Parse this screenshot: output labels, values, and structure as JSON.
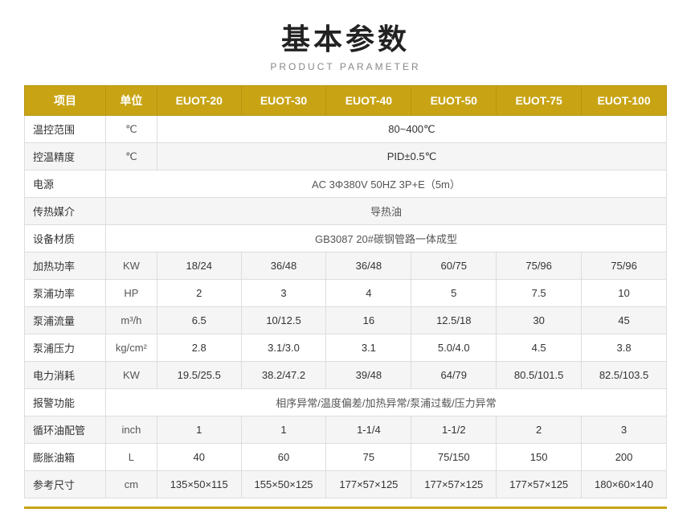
{
  "title": {
    "main": "基本参数",
    "sub": "PRODUCT PARAMETER"
  },
  "table": {
    "headers": [
      "项目",
      "单位",
      "EUOT-20",
      "EUOT-30",
      "EUOT-40",
      "EUOT-50",
      "EUOT-75",
      "EUOT-100"
    ],
    "rows": [
      {
        "label": "温控范围",
        "unit": "℃",
        "span": true,
        "span_value": "80~400℃",
        "span_cols": 6
      },
      {
        "label": "控温精度",
        "unit": "℃",
        "span": true,
        "span_value": "PID±0.5℃",
        "span_cols": 6
      },
      {
        "label": "电源",
        "unit": "",
        "span": true,
        "span_value": "AC 3Φ380V 50HZ 3P+E（5m）",
        "span_cols": 7
      },
      {
        "label": "传热媒介",
        "unit": "",
        "span": true,
        "span_value": "导热油",
        "span_cols": 7
      },
      {
        "label": "设备材质",
        "unit": "",
        "span": true,
        "span_value": "GB3087   20#碳钢管路一体成型",
        "span_cols": 7
      },
      {
        "label": "加热功率",
        "unit": "KW",
        "span": false,
        "values": [
          "18/24",
          "36/48",
          "36/48",
          "60/75",
          "75/96",
          "75/96"
        ]
      },
      {
        "label": "泵浦功率",
        "unit": "HP",
        "span": false,
        "values": [
          "2",
          "3",
          "4",
          "5",
          "7.5",
          "10"
        ]
      },
      {
        "label": "泵浦流量",
        "unit": "m³/h",
        "span": false,
        "values": [
          "6.5",
          "10/12.5",
          "16",
          "12.5/18",
          "30",
          "45"
        ]
      },
      {
        "label": "泵浦压力",
        "unit": "kg/cm²",
        "span": false,
        "values": [
          "2.8",
          "3.1/3.0",
          "3.1",
          "5.0/4.0",
          "4.5",
          "3.8"
        ]
      },
      {
        "label": "电力消耗",
        "unit": "KW",
        "span": false,
        "values": [
          "19.5/25.5",
          "38.2/47.2",
          "39/48",
          "64/79",
          "80.5/101.5",
          "82.5/103.5"
        ]
      },
      {
        "label": "报警功能",
        "unit": "",
        "span": true,
        "span_value": "相序异常/温度偏差/加热异常/泵浦过载/压力异常",
        "span_cols": 7
      },
      {
        "label": "循环油配管",
        "unit": "inch",
        "span": false,
        "values": [
          "1",
          "1",
          "1-1/4",
          "1-1/2",
          "2",
          "3"
        ]
      },
      {
        "label": "膨胀油箱",
        "unit": "L",
        "span": false,
        "values": [
          "40",
          "60",
          "75",
          "75/150",
          "150",
          "200"
        ]
      },
      {
        "label": "参考尺寸",
        "unit": "cm",
        "span": false,
        "values": [
          "135×50×115",
          "155×50×125",
          "177×57×125",
          "177×57×125",
          "177×57×125",
          "180×60×140"
        ]
      }
    ]
  }
}
